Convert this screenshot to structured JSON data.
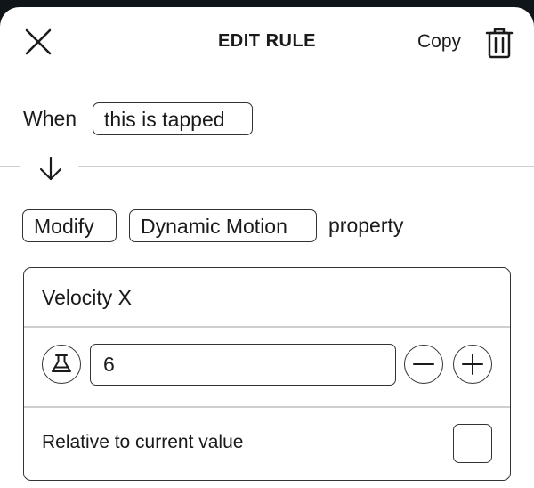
{
  "header": {
    "title": "EDIT RULE",
    "copy_label": "Copy",
    "close_icon": "close-icon",
    "delete_icon": "trash-icon"
  },
  "trigger": {
    "when_label": "When",
    "event_chip": "this is tapped"
  },
  "action": {
    "verb_chip": "Modify",
    "target_chip": "Dynamic Motion",
    "suffix_label": "property"
  },
  "property_card": {
    "name": "Velocity X",
    "value": "6",
    "formula_icon": "flask-icon",
    "decrement_icon": "minus-icon",
    "increment_icon": "plus-icon",
    "relative_label": "Relative to current value",
    "relative_checked": false
  },
  "colors": {
    "background": "#0f1518",
    "sheet": "#ffffff",
    "border": "#333333",
    "divider": "#cfcfcf"
  }
}
